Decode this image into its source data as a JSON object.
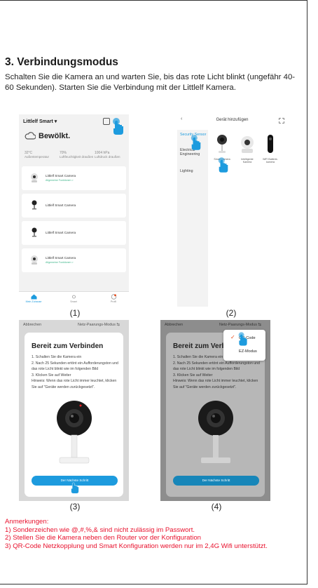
{
  "heading": "3. Verbindungsmodus",
  "intro": "Schalten Sie die Kamera an und warten Sie, bis das rote Licht blinkt (ungefähr 40-60 Sekunden). Starten Sie die Verbindung mit der Littlelf Kamera.",
  "screen1": {
    "header": "Littlelf Smart ▾",
    "weather": "Bewölkt.",
    "stats": [
      {
        "value": "32°C",
        "label": "Außentemperatur"
      },
      {
        "value": "70%",
        "label": "Luftfeuchtigkeit draußen"
      },
      {
        "value": "1004 hPa",
        "label": "Luftdruck draußen"
      }
    ],
    "devices": [
      {
        "name": "Littlelf Smart Camera",
        "sub": "Allgemeine Funktionen >"
      },
      {
        "name": "Littlelf Smart Camera",
        "sub": ""
      },
      {
        "name": "Littlelf Smart Camera",
        "sub": ""
      },
      {
        "name": "Littlelf Smart Camera",
        "sub": "Allgemeine Funktionen >"
      }
    ],
    "tabs": [
      "Mein Zuhause",
      "Smart",
      "Profil"
    ],
    "caption": "(1)"
  },
  "screen2": {
    "title": "Gerät hinzufügen",
    "categories": [
      "Security Sensor",
      "Electrical Engineering",
      "Lighting"
    ],
    "devices": [
      "Smart Camera",
      "Intelligente Kamera",
      "WiFi Batterie-kamera"
    ],
    "caption": "(2)"
  },
  "screen3": {
    "cancel": "Abbrechen",
    "mode": "Netz-Paarungs-Modus ⇆",
    "title": "Bereit zum Verbinden",
    "steps": [
      "1. Schalten Sie die Kamera ein",
      "2. Nach 25 Sekunden ertönt ein Aufforderungston und das rote Licht blinkt wie im folgenden Bild",
      "3. Klicken Sie auf Weiter",
      "Hinweis: Wenn das rote Licht immer leuchtet, klicken Sie auf \"Geräte werden zurückgesetzt\"."
    ],
    "button": "Der Nächste Schritt",
    "caption": "(3)"
  },
  "screen4": {
    "cancel": "Abbrechen",
    "mode": "Netz-Paarungs-Modus ⇆",
    "title": "Bereit zum Verbinden",
    "steps": [
      "1. Schalten Sie die Kamera ein",
      "2. Nach 25 Sekunden ertönt ein Aufforderungston und das rote Licht blinkt wie im folgenden Bild",
      "3. Klicken Sie auf Weiter",
      "Hinweis: Wenn das rote Licht immer leuchtet, klicken Sie auf \"Geräte werden zurückgesetzt\"."
    ],
    "popup": [
      "QR-Code",
      "EZ-Modus"
    ],
    "button": "Der Nächste Schritt",
    "caption": "(4)"
  },
  "notes": [
    "Anmerkungen:",
    "1) Sonderzeichen wie @,#,%,& sind nicht zulässig im Passwort.",
    "2) Stellen Sie die Kamera neben den Router vor der Konfiguration",
    "3) QR-Code Netzkopplung und Smart Konfiguration werden nur im 2,4G Wifi unterstützt."
  ],
  "colors": {
    "accent": "#1d9bde",
    "note": "#e8112d",
    "success": "#3fb68b"
  }
}
